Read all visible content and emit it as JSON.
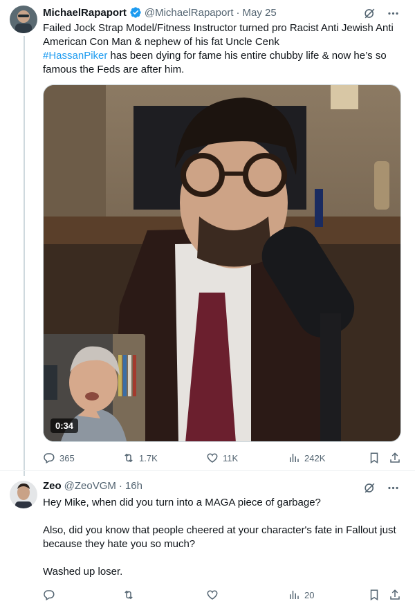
{
  "tweet1": {
    "name": "MichaelRapaport",
    "handle": "@MichaelRapaport",
    "separator": "·",
    "time": "May 25",
    "text_line1": "Failed Jock Strap Model/Fitness Instructor turned pro Racist Anti Jewish Anti American Con Man & nephew of his fat Uncle Cenk",
    "hashtag": "#HassanPiker",
    "text_line2": " has been dying for fame his entire chubby life & now he’s so famous the Feds are after him.",
    "video_duration": "0:34",
    "replies": "365",
    "reposts": "1.7K",
    "likes": "11K",
    "views": "242K"
  },
  "tweet2": {
    "name": "Zeo",
    "handle": "@ZeoVGM",
    "separator": "·",
    "time": "16h",
    "paragraphs": [
      "Hey Mike, when did you turn into a MAGA piece of garbage?",
      "Also, did you know that people cheered at your character's fate in Fallout just because they hate you so much?",
      "Washed up loser."
    ],
    "replies": "",
    "reposts": "",
    "likes": "",
    "views": "20"
  },
  "icons": {
    "verified": "verified-badge-icon",
    "grok": "grok-icon",
    "more": "more-icon",
    "reply": "reply-icon",
    "repost": "repost-icon",
    "like": "like-icon",
    "views": "views-icon",
    "bookmark": "bookmark-icon",
    "share": "share-icon"
  },
  "colors": {
    "text": "#0f1419",
    "secondary": "#536471",
    "accent": "#1d9bf0"
  }
}
